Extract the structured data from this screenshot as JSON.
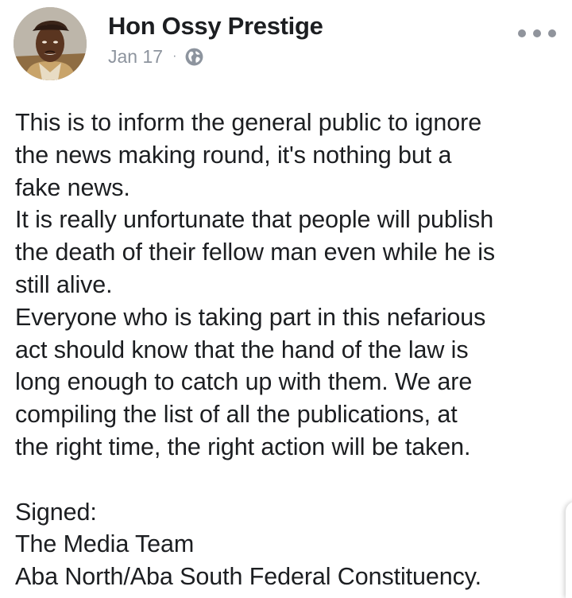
{
  "post": {
    "author": {
      "name": "Hon Ossy Prestige",
      "avatar_icon": "profile-photo"
    },
    "meta": {
      "date": "Jan 17",
      "separator": "·",
      "privacy_icon": "globe-icon"
    },
    "more_icon": "more-options-icon",
    "body_lines": [
      "This is to inform the general public to ignore",
      "the news making round, it's nothing but a",
      "fake news.",
      "It is really unfortunate that people will publish",
      "the death of their fellow man even while he is",
      "still alive.",
      "Everyone who is taking part in this nefarious",
      "act should know that the hand of the law is",
      "long enough to catch up with them. We are",
      "compiling the list of all the publications, at",
      "the right time, the right action will be taken.",
      "",
      "Signed:",
      "The Media Team",
      "Aba North/Aba South Federal Constituency."
    ]
  },
  "colors": {
    "text": "#1c1e21",
    "meta": "#8d949e",
    "background": "#ffffff"
  }
}
